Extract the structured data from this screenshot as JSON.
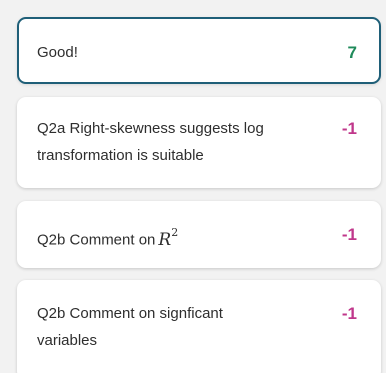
{
  "rubric_items": [
    {
      "text": "Good!",
      "points": "7",
      "selected": true
    },
    {
      "line1": "Q2a Right-skewness suggests log",
      "line2": "transformation is suitable",
      "points": "-1"
    },
    {
      "text": "Q2b Comment on",
      "math_var": "R",
      "math_exp": "2",
      "points": "-1"
    },
    {
      "line1": "Q2b Comment on signficant",
      "line2": "variables",
      "points": "-1"
    }
  ],
  "colors": {
    "positive": "#1f8a5a",
    "negative": "#c0378b",
    "selected_border": "#1f5f78",
    "card_bg": "#ffffff",
    "panel_bg": "#f2f2f2"
  }
}
